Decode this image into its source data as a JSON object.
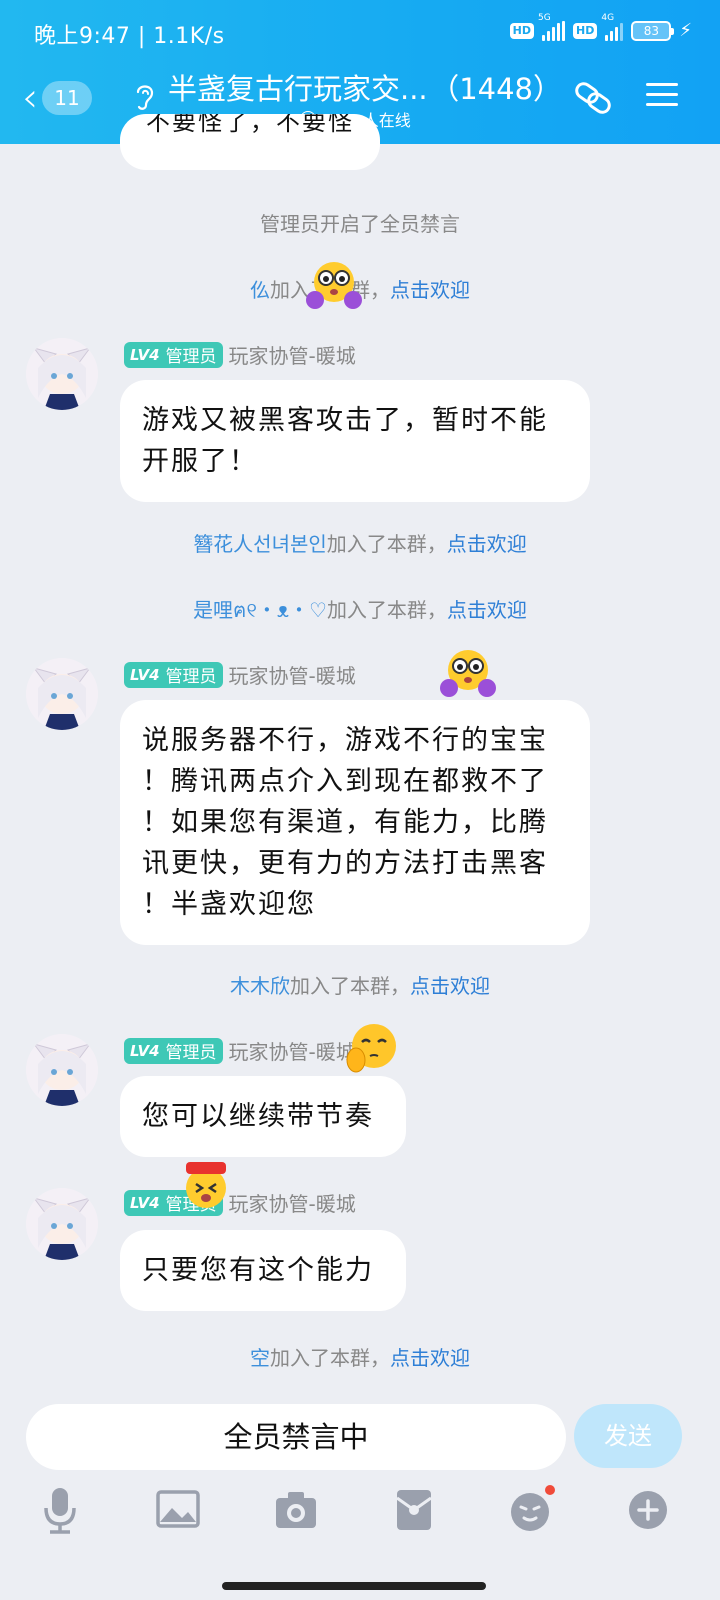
{
  "status_bar": {
    "time": "晚上9:47 | 1.1K/s",
    "network_1": "5G",
    "network_2": "4G",
    "hd_1": "HD",
    "hd_2": "HD",
    "battery": "83"
  },
  "header": {
    "unread_count": "11",
    "title": "半盏复古行玩家交...",
    "member_count": "（1448）",
    "online_text": "1139人在线"
  },
  "chat": {
    "partial_top_message": "不要怪了，不要怪",
    "system_mute": "管理员开启了全员禁言",
    "joins": [
      {
        "nick": "仫",
        "text": "加入了本群，",
        "action": "点击欢迎"
      },
      {
        "nick": "簪花人선녀본인",
        "text": "加入了本群，",
        "action": "点击欢迎"
      },
      {
        "nick": "是哩ฅ୧・ᴥ・♡",
        "text": "加入了本群，",
        "action": "点击欢迎"
      },
      {
        "nick": "木木欣",
        "text": "加入了本群，",
        "action": "点击欢迎"
      },
      {
        "nick": "空",
        "text": "加入了本群，",
        "action": "点击欢迎"
      }
    ],
    "sender": {
      "level": "LV4",
      "role": "管理员",
      "name": "玩家协管-暖城"
    },
    "messages": [
      {
        "line1": "游戏又被黑客攻击了，暂时不能",
        "line2": "开服了！"
      },
      {
        "line1": "说服务器不行，游戏不行的宝宝",
        "line2": "！腾讯两点介入到现在都救不了",
        "line3": "！如果您有渠道，有能力，比腾",
        "line4": "讯更快，更有力的方法打击黑客",
        "line5": "！半盏欢迎您"
      },
      {
        "line1": "您可以继续带节奏"
      },
      {
        "line1": "只要您有这个能力"
      }
    ]
  },
  "input": {
    "placeholder": "全员禁言中",
    "send_label": "发送"
  },
  "toolbar": [
    "mic-icon",
    "image-icon",
    "camera-icon",
    "red-packet-icon",
    "emoji-icon",
    "plus-icon"
  ],
  "colors": {
    "header": "#16aaf2",
    "badge": "#3ec8b6",
    "link": "#2e7fd6",
    "background": "#eceef3"
  }
}
